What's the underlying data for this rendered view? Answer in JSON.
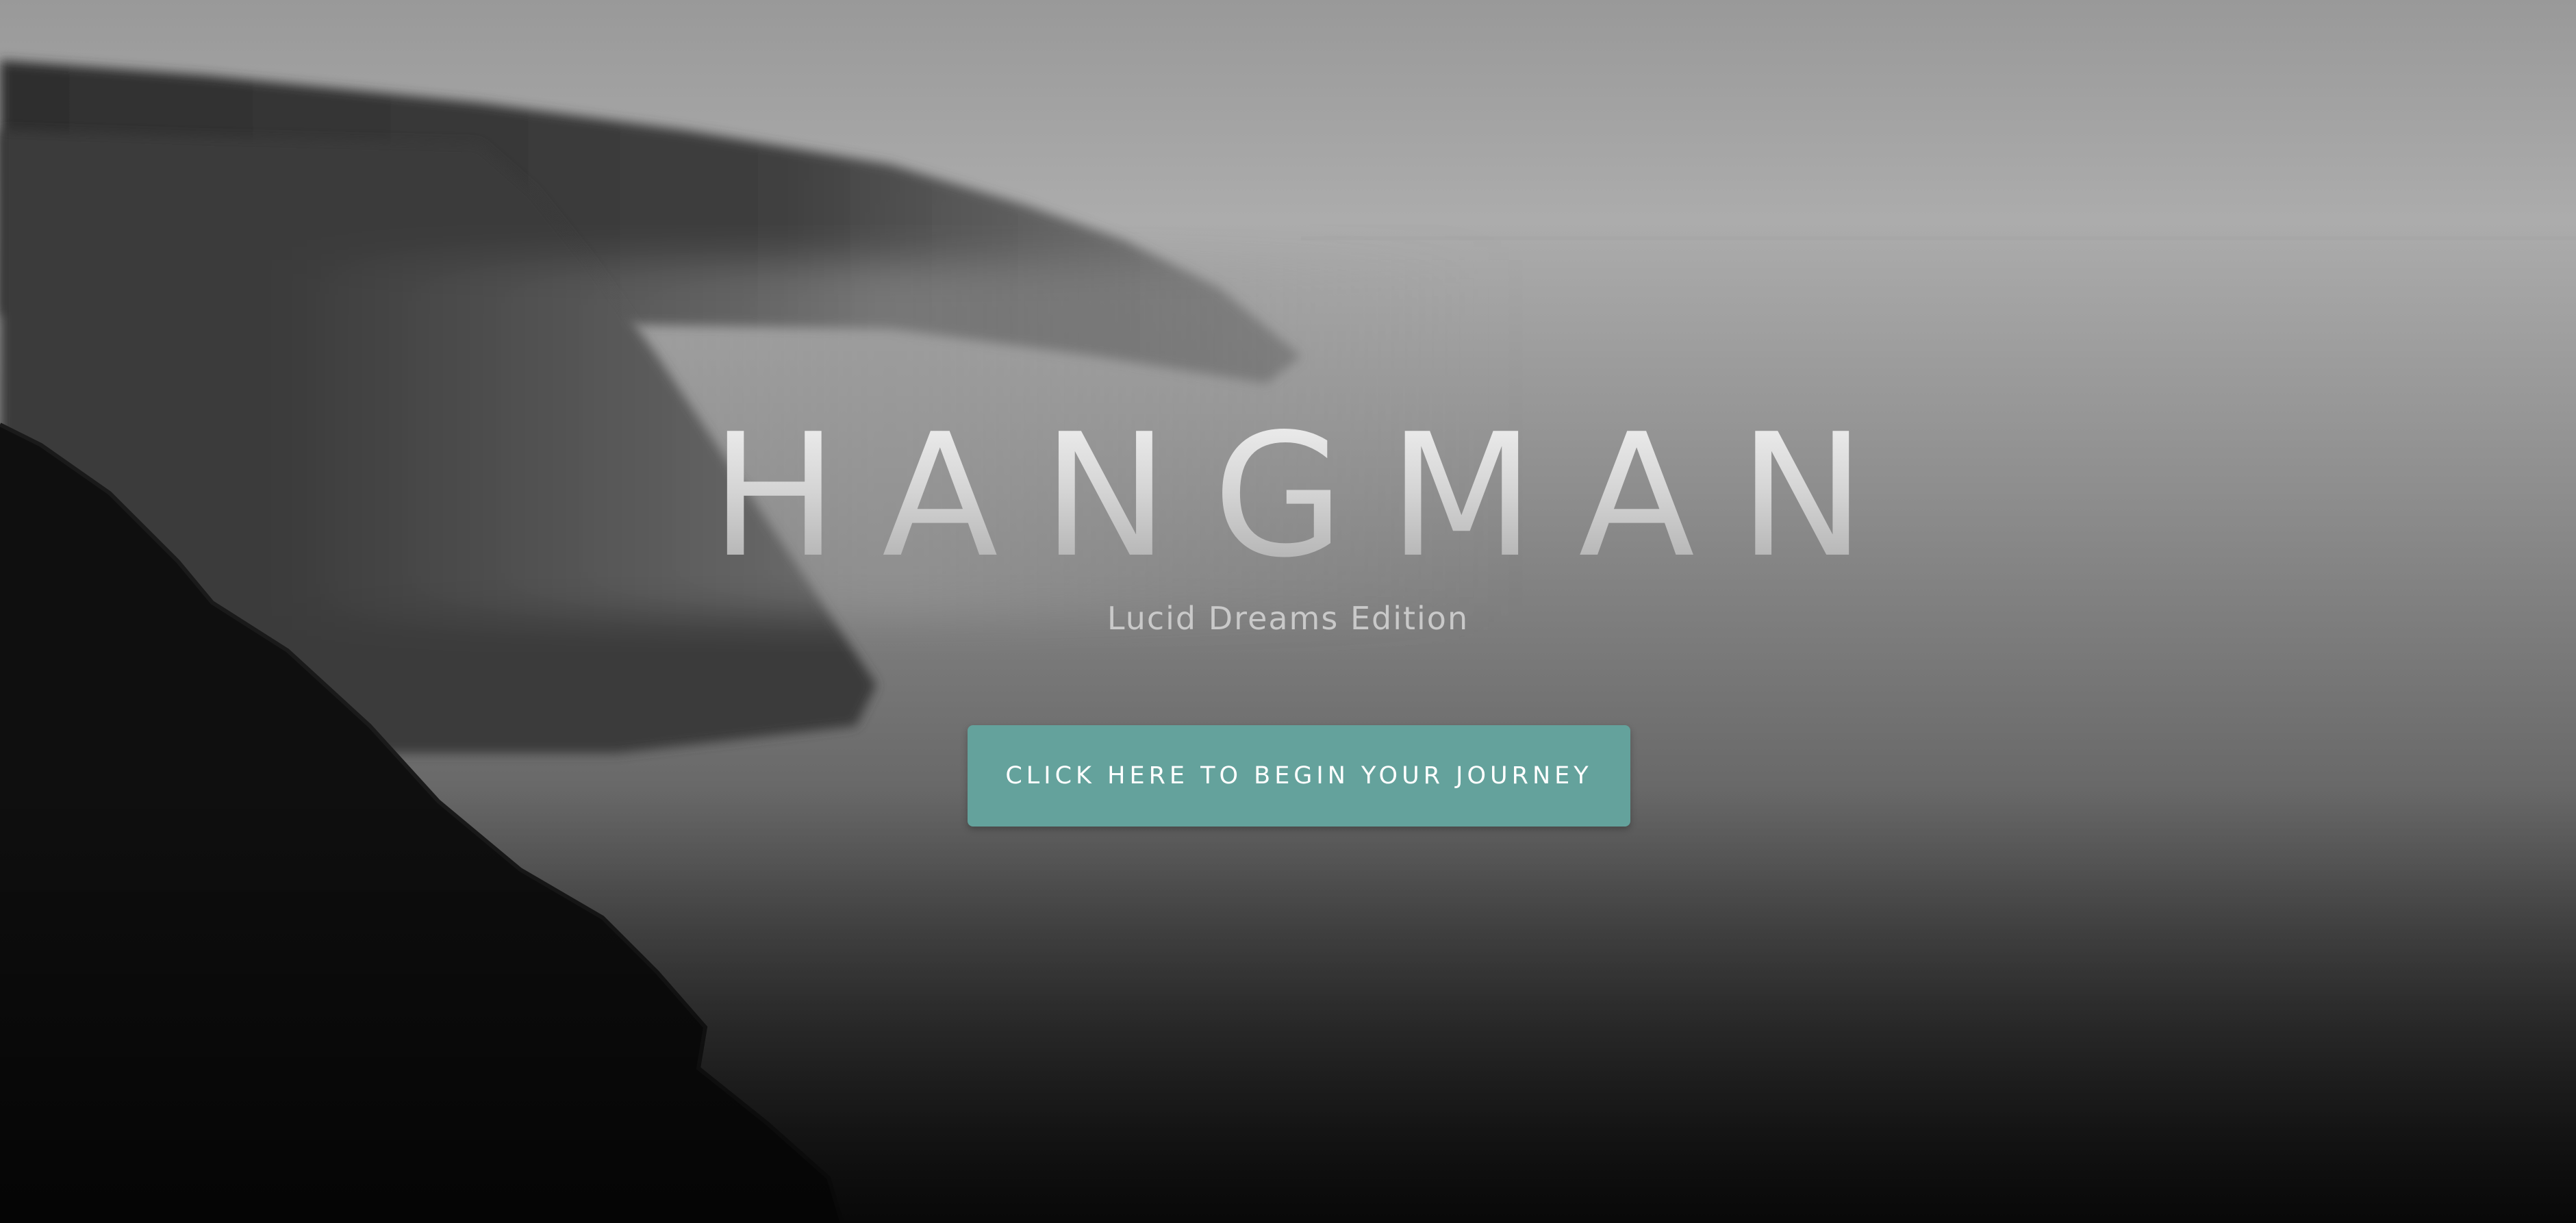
{
  "hero": {
    "title": "HANGMAN",
    "subtitle": "Lucid Dreams Edition",
    "cta_label": "CLICK HERE TO BEGIN YOUR JOURNEY"
  },
  "colors": {
    "button_bg": "#64a29c",
    "button_text": "#ffffff",
    "subtitle_text": "#c9c9c9",
    "title_text": "#d9d9d9"
  },
  "background": {
    "description_icon": "misty-sea-cliffs-photo"
  }
}
